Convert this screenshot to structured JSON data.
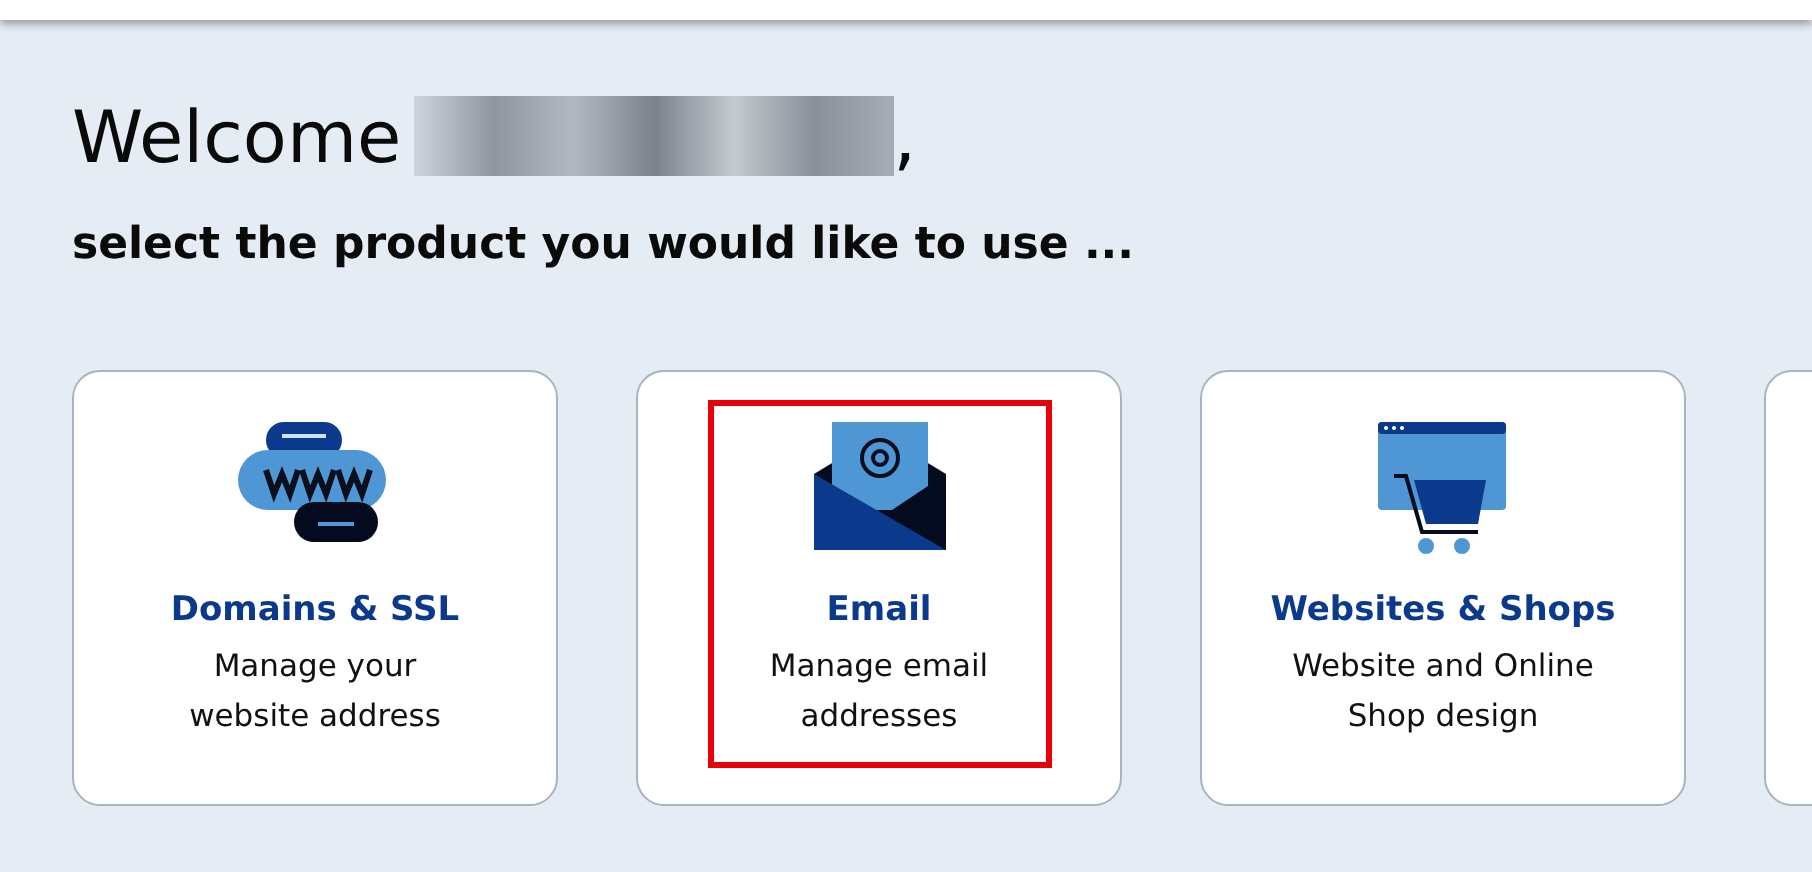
{
  "greeting": {
    "text": "Welcome",
    "name_redacted": true,
    "suffix": ","
  },
  "subtitle": "select the product you would like to use ...",
  "products": [
    {
      "kind": "domains",
      "title": "Domains & SSL",
      "description": "Manage your website address",
      "highlighted": false
    },
    {
      "kind": "email",
      "title": "Email",
      "description": "Manage email addresses",
      "highlighted": true
    },
    {
      "kind": "shop",
      "title": "Websites & Shops",
      "description": "Website and Online Shop design",
      "highlighted": false
    }
  ]
}
